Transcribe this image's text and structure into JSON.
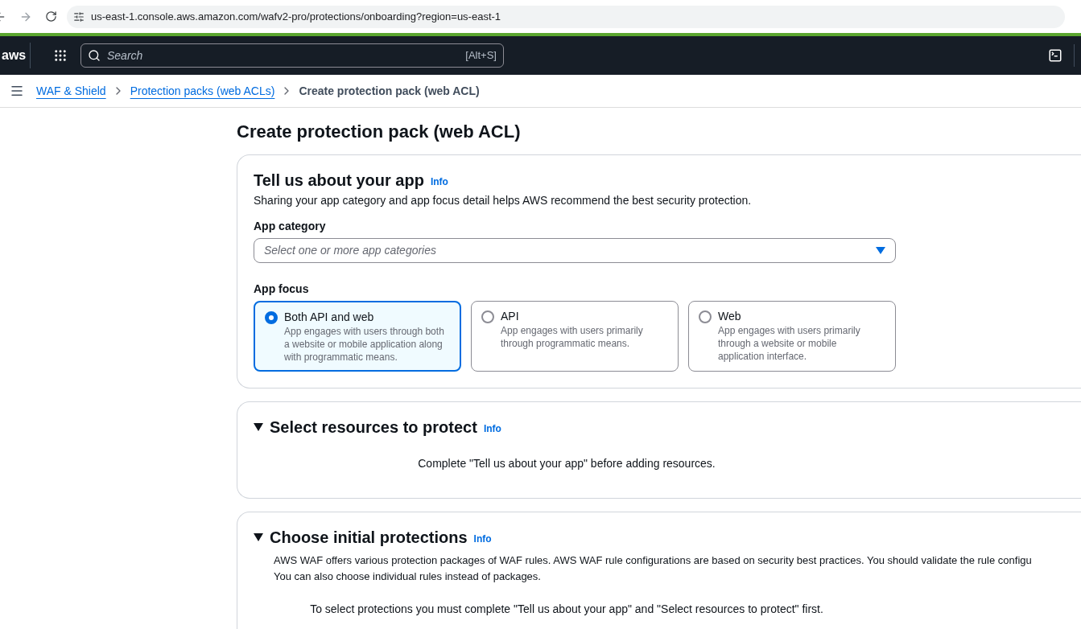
{
  "browser": {
    "url": "us-east-1.console.aws.amazon.com/wafv2-pro/protections/onboarding?region=us-east-1"
  },
  "topnav": {
    "logo": "aws",
    "search": {
      "placeholder": "Search",
      "shortcut": "[Alt+S]"
    }
  },
  "breadcrumbs": [
    {
      "label": "WAF & Shield",
      "kind": "link"
    },
    {
      "label": "Protection packs (web ACLs)",
      "kind": "link"
    },
    {
      "label": "Create protection pack (web ACL)",
      "kind": "current"
    }
  ],
  "page_title": "Create protection pack (web ACL)",
  "app_section": {
    "title": "Tell us about your app",
    "info": "Info",
    "description": "Sharing your app category and app focus detail helps AWS recommend the best security protection.",
    "category": {
      "label": "App category",
      "placeholder": "Select one or more app categories"
    },
    "focus": {
      "label": "App focus",
      "options": [
        {
          "title": "Both API and web",
          "description": "App engages with users through both a website or mobile application along with programmatic means.",
          "selected": true
        },
        {
          "title": "API",
          "description": "App engages with users primarily through programmatic means.",
          "selected": false
        },
        {
          "title": "Web",
          "description": "App engages with users primarily through a website or mobile application interface.",
          "selected": false
        }
      ]
    }
  },
  "sections": [
    {
      "title": "Select resources to protect",
      "info": "Info",
      "expanded": true,
      "message": "Complete \"Tell us about your app\" before adding resources."
    },
    {
      "title": "Choose initial protections",
      "info": "Info",
      "expanded": true,
      "description": [
        "AWS WAF offers various protection packages of WAF rules. AWS WAF rule configurations are based on security best practices. You should validate the rule configu",
        "You can also choose individual rules instead of packages."
      ],
      "message": "To select protections you must complete \"Tell us about your app\" and \"Select resources to protect\" first."
    }
  ]
}
